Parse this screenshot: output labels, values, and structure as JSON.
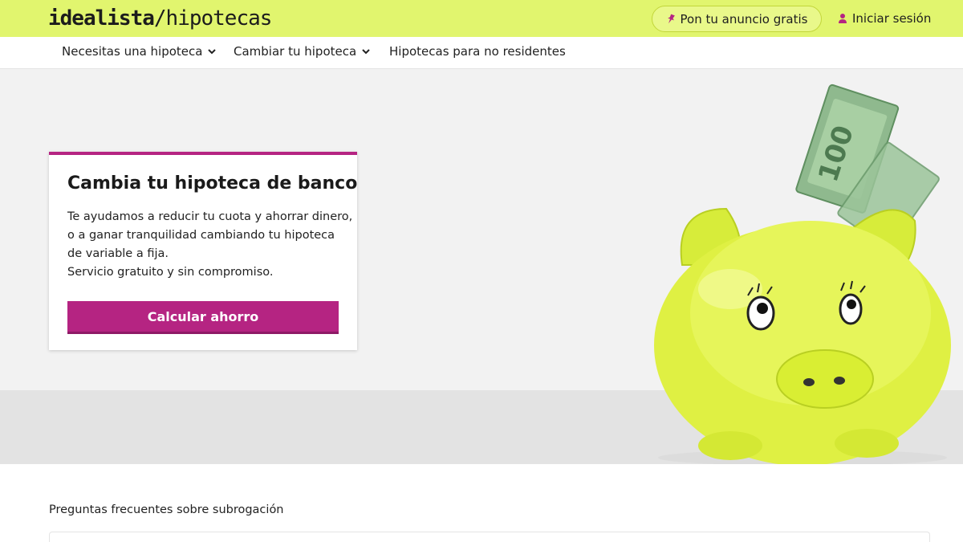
{
  "header": {
    "logo_brand": "idealista",
    "logo_product": "/hipotecas",
    "publish_button": "Pon tu anuncio gratis",
    "login_link": "Iniciar sesión",
    "icons": {
      "publish": "pin-icon",
      "login": "user-icon"
    },
    "colors": {
      "bar": "#e1f56e"
    }
  },
  "nav": {
    "items": [
      {
        "label": "Necesitas una hipoteca",
        "dropdown": true
      },
      {
        "label": "Cambiar tu hipoteca",
        "dropdown": true
      },
      {
        "label": "Hipotecas para no residentes",
        "dropdown": false
      }
    ]
  },
  "hero": {
    "card": {
      "title": "Cambia tu hipoteca de banco",
      "body_lines": [
        "Te ayudamos a reducir tu cuota y ahorrar dinero,",
        "o a ganar tranquilidad cambiando tu hipoteca",
        "de variable a fija.",
        "Servicio gratuito y sin compromiso."
      ],
      "cta_label": "Calcular ahorro",
      "accent_color": "#b52482"
    },
    "image": "piggy-bank-with-100-euro-notes"
  },
  "faq": {
    "title": "Preguntas frecuentes sobre subrogación"
  }
}
